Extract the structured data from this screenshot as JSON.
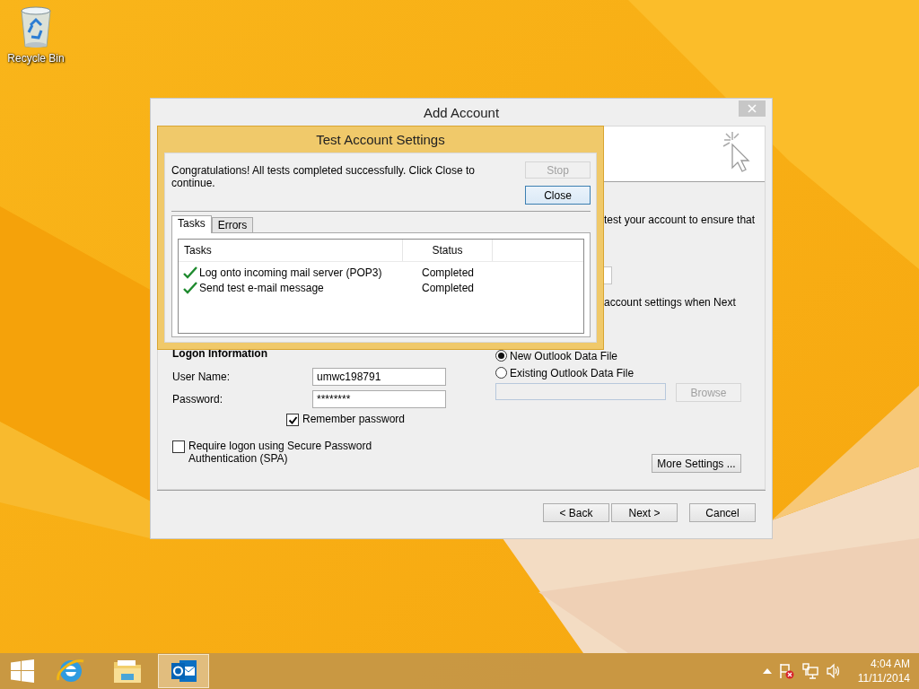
{
  "desktop": {
    "icons": [
      {
        "label": "Recycle Bin"
      }
    ]
  },
  "add_account": {
    "title": "Add Account",
    "intro_fragment": "test your account to ensure that",
    "note_fragment": "account settings when Next",
    "logon_heading": "Logon Information",
    "fields": [
      {
        "label": "User Name:",
        "value": "umwc198791"
      },
      {
        "label": "Password:",
        "value": "********"
      }
    ],
    "remember": {
      "label": "Remember password",
      "checked": true
    },
    "spa": {
      "label": "Require logon using Secure Password Authentication (SPA)",
      "checked": false
    },
    "data_file_options": [
      {
        "label": "New Outlook Data File",
        "selected": true
      },
      {
        "label": "Existing Outlook Data File",
        "selected": false
      }
    ],
    "browse": {
      "label": "Browse",
      "disabled": true
    },
    "more_settings": "More Settings ...",
    "buttons": [
      "< Back",
      "Next >",
      "Cancel"
    ]
  },
  "test_dialog": {
    "title": "Test Account Settings",
    "message": "Congratulations! All tests completed successfully. Click Close to continue.",
    "buttons": [
      {
        "label": "Stop",
        "disabled": true
      },
      {
        "label": "Close",
        "disabled": false
      }
    ],
    "tabs": [
      {
        "label": "Tasks",
        "selected": true
      },
      {
        "label": "Errors",
        "selected": false
      }
    ],
    "columns": [
      "Tasks",
      "Status"
    ],
    "rows": [
      {
        "task": "Log onto incoming mail server (POP3)",
        "status": "Completed"
      },
      {
        "task": "Send test e-mail message",
        "status": "Completed"
      }
    ]
  },
  "taskbar": {
    "apps": [
      {
        "kind": "browser",
        "selected": false
      },
      {
        "kind": "folder",
        "selected": false
      },
      {
        "kind": "mail",
        "selected": true
      }
    ]
  },
  "clock": {
    "time": "4:04 AM",
    "date": "11/11/2014"
  }
}
